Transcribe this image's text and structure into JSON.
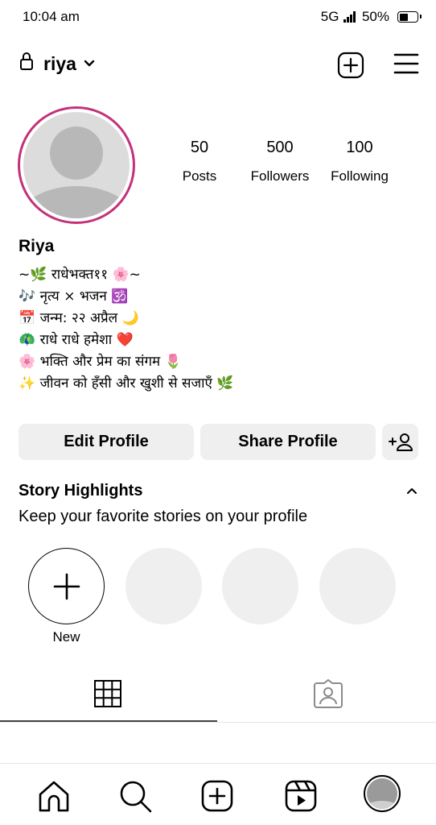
{
  "status_bar": {
    "time": "10:04 am",
    "network": "5G",
    "battery": "50%",
    "battery_level": 0.5
  },
  "header": {
    "username": "riya",
    "icons": [
      "lock-icon",
      "chevron-down-icon",
      "add-post-icon",
      "menu-icon"
    ]
  },
  "stats": {
    "posts": {
      "value": "50",
      "label": "Posts"
    },
    "followers": {
      "value": "500",
      "label": "Followers"
    },
    "following": {
      "value": "100",
      "label": "Following"
    }
  },
  "profile": {
    "name": "Riya",
    "bio": [
      "~🌿 राधेभक्त११ 🌸~",
      "🎶 नृत्य × भजन 🕉️",
      "📅 जन्म: २२ अप्रैल 🌙",
      "🦚 राधे राधे हमेशा ❤️",
      "🌸 भक्ति और प्रेम का संगम 🌷",
      "✨ जीवन को हँसी और खुशी से सजाएँ 🌿"
    ]
  },
  "buttons": {
    "edit": "Edit Profile",
    "share": "Share Profile"
  },
  "highlights": {
    "title": "Story Highlights",
    "subtitle": "Keep your favorite stories on your profile",
    "new_label": "New"
  },
  "tabs": [
    "grid-icon",
    "tagged-icon"
  ],
  "bottom_nav": [
    "home-icon",
    "search-icon",
    "create-icon",
    "reels-icon",
    "profile-avatar"
  ]
}
